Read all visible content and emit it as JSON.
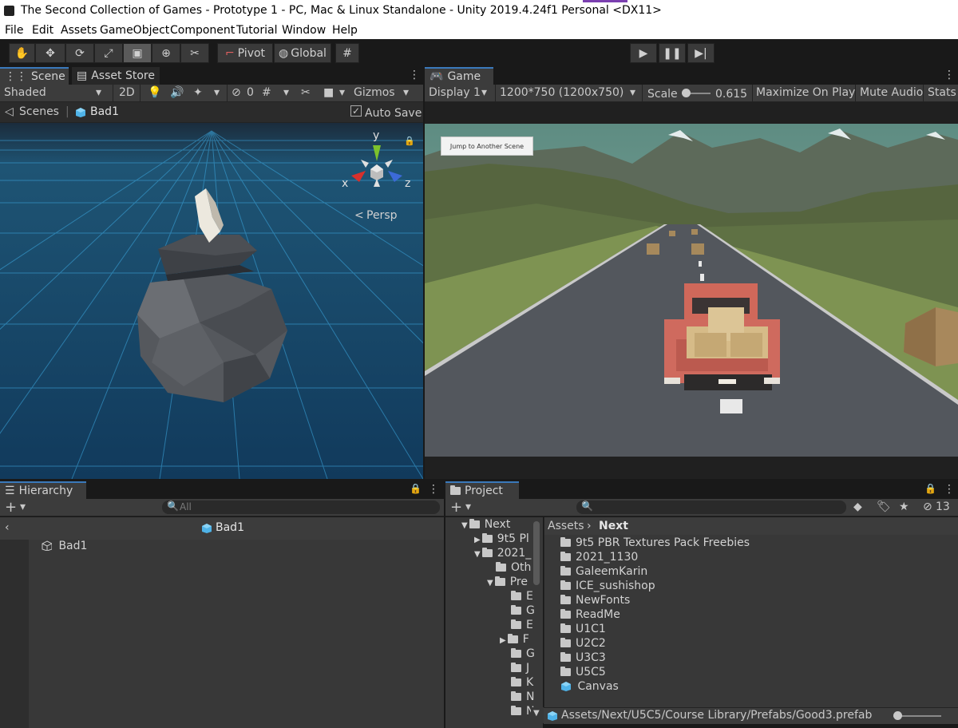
{
  "window": {
    "title": "The Second Collection of Games - Prototype 1 - PC, Mac & Linux Standalone - Unity 2019.4.24f1 Personal <DX11>"
  },
  "menu": [
    "File",
    "Edit",
    "Assets",
    "GameObject",
    "Component",
    "Tutorial",
    "Window",
    "Help"
  ],
  "toolbar": {
    "pivot": "Pivot",
    "global": "Global"
  },
  "scene": {
    "tab": "Scene",
    "asset_store_tab": "Asset Store",
    "shading": "Shaded",
    "mode_2d": "2D",
    "hidden_count": "0",
    "gizmos": "Gizmos",
    "breadcrumb_root": "Scenes",
    "breadcrumb_current": "Bad1",
    "auto_save": "Auto Save",
    "persp": "Persp",
    "axis_x": "x",
    "axis_y": "y",
    "axis_z": "z"
  },
  "game": {
    "tab": "Game",
    "display": "Display 1",
    "resolution": "1200*750 (1200x750)",
    "scale_label": "Scale",
    "scale_value": "0.615",
    "maximize": "Maximize On Play",
    "mute": "Mute Audio",
    "stats": "Stats",
    "ui_button": "Jump to Another Scene"
  },
  "hierarchy": {
    "tab": "Hierarchy",
    "search_placeholder": "All",
    "context": "Bad1",
    "items": [
      "Bad1"
    ]
  },
  "project": {
    "tab": "Project",
    "hidden_count": "13",
    "tree": [
      "Next",
      "9t5 Pl",
      "2021_",
      "Oth",
      "Pre",
      "E",
      "G",
      "E",
      "F",
      "G",
      "J",
      "K",
      "N",
      "N"
    ],
    "breadcrumb_root": "Assets",
    "breadcrumb_current": "Next",
    "items": [
      {
        "name": "9t5 PBR Textures Pack Freebies",
        "type": "folder"
      },
      {
        "name": "2021_1130",
        "type": "folder"
      },
      {
        "name": "GaleemKarin",
        "type": "folder"
      },
      {
        "name": "ICE_sushishop",
        "type": "folder"
      },
      {
        "name": "NewFonts",
        "type": "folder"
      },
      {
        "name": "ReadMe",
        "type": "folder"
      },
      {
        "name": "U1C1",
        "type": "folder"
      },
      {
        "name": "U2C2",
        "type": "folder"
      },
      {
        "name": "U3C3",
        "type": "folder"
      },
      {
        "name": "U5C5",
        "type": "folder"
      },
      {
        "name": "Canvas",
        "type": "prefab"
      }
    ],
    "status_path": "Assets/Next/U5C5/Course Library/Prefabs/Good3.prefab"
  },
  "colors": {
    "accent_blue": "#3a79bb",
    "prefab_blue": "#4fb3e8",
    "panel": "#383838",
    "scene_bg": "#1a4a70"
  }
}
